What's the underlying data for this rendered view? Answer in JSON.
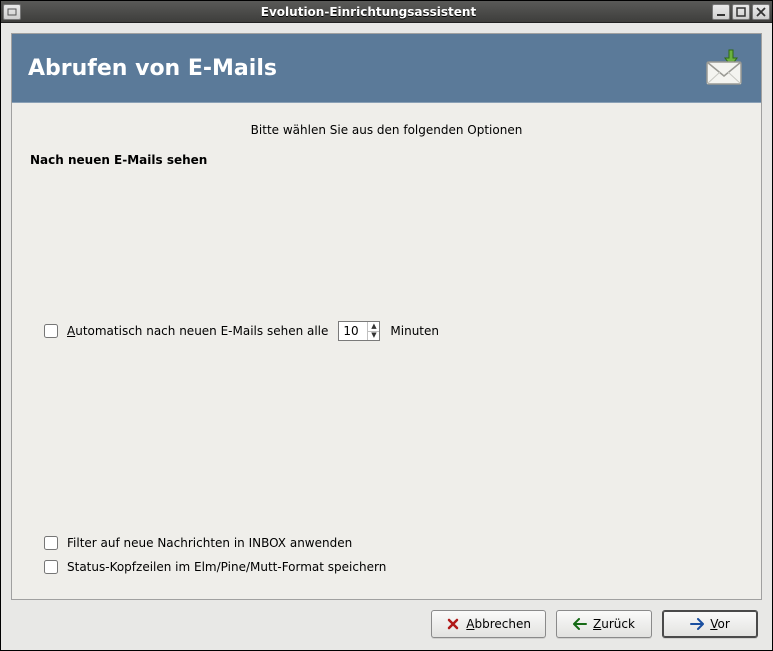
{
  "window": {
    "title": "Evolution-Einrichtungsassistent"
  },
  "banner": {
    "heading": "Abrufen von E-Mails"
  },
  "content": {
    "instruction": "Bitte wählen Sie aus den folgenden Optionen",
    "section_title": "Nach neuen E-Mails sehen",
    "auto_check": {
      "label_before": "Automatisch nach neuen E-Mails sehen alle",
      "value": "10",
      "unit": "Minuten",
      "checked": false
    },
    "filter_check": {
      "label": "Filter auf neue Nachrichten in INBOX anwenden",
      "checked": false
    },
    "status_check": {
      "label": "Status-Kopfzeilen im Elm/Pine/Mutt-Format speichern",
      "checked": false
    }
  },
  "buttons": {
    "cancel": "Abbrechen",
    "back": "Zurück",
    "forward": "Vor"
  }
}
